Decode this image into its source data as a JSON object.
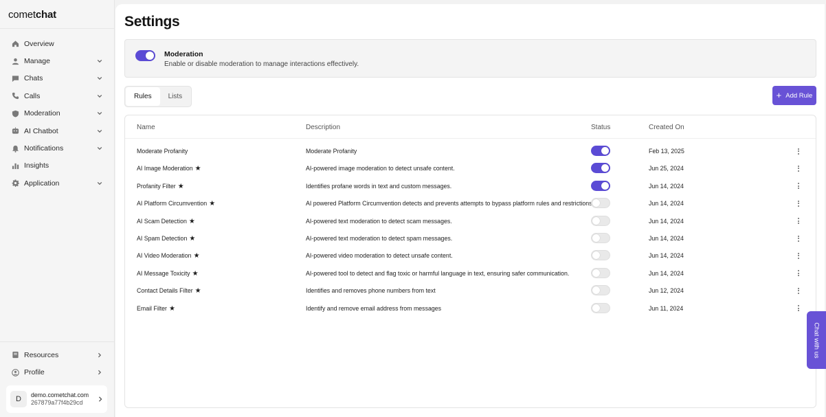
{
  "brand": {
    "logo_light": "comet",
    "logo_bold": "chat"
  },
  "sidebar": {
    "items": [
      {
        "label": "Overview",
        "icon": "home-icon",
        "chevron": false
      },
      {
        "label": "Manage",
        "icon": "user-icon",
        "chevron": true
      },
      {
        "label": "Chats",
        "icon": "chat-icon",
        "chevron": true
      },
      {
        "label": "Calls",
        "icon": "phone-icon",
        "chevron": true
      },
      {
        "label": "Moderation",
        "icon": "shield-icon",
        "chevron": true
      },
      {
        "label": "AI Chatbot",
        "icon": "bot-icon",
        "chevron": true
      },
      {
        "label": "Notifications",
        "icon": "bell-icon",
        "chevron": true
      },
      {
        "label": "Insights",
        "icon": "bar-chart-icon",
        "chevron": false
      },
      {
        "label": "Application",
        "icon": "gear-icon",
        "chevron": true
      }
    ],
    "bottom_items": [
      {
        "label": "Resources",
        "icon": "book-icon"
      },
      {
        "label": "Profile",
        "icon": "profile-icon"
      }
    ],
    "account": {
      "initial": "D",
      "domain": "demo.cometchat.com",
      "id": "267879a77f4b29cd"
    }
  },
  "page": {
    "title": "Settings",
    "moderation": {
      "title": "Moderation",
      "description": "Enable or disable moderation to manage interactions effectively.",
      "enabled": true
    },
    "tabs": [
      "Rules",
      "Lists"
    ],
    "active_tab": "Rules",
    "add_button": "Add Rule",
    "table": {
      "headers": {
        "name": "Name",
        "description": "Description",
        "status": "Status",
        "created": "Created On"
      },
      "rows": [
        {
          "name": "Moderate Profanity",
          "star": false,
          "description": "Moderate Profanity",
          "enabled": true,
          "created": "Feb 13, 2025"
        },
        {
          "name": "AI Image Moderation",
          "star": true,
          "description": "AI-powered image moderation to detect unsafe content.",
          "enabled": true,
          "created": "Jun 25, 2024"
        },
        {
          "name": "Profanity Filter",
          "star": true,
          "description": "Identifies profane words in text and custom messages.",
          "enabled": true,
          "created": "Jun 14, 2024"
        },
        {
          "name": "AI Platform Circumvention",
          "star": true,
          "description": "AI powered Platform Circumvention detects and prevents attempts to bypass platform rules and restrictions.",
          "enabled": false,
          "created": "Jun 14, 2024"
        },
        {
          "name": "AI Scam Detection",
          "star": true,
          "description": "AI-powered text moderation to detect scam messages.",
          "enabled": false,
          "created": "Jun 14, 2024"
        },
        {
          "name": "AI Spam Detection",
          "star": true,
          "description": "AI-powered text moderation to detect spam messages.",
          "enabled": false,
          "created": "Jun 14, 2024"
        },
        {
          "name": "AI Video Moderation",
          "star": true,
          "description": "AI-powered video moderation to detect unsafe content.",
          "enabled": false,
          "created": "Jun 14, 2024"
        },
        {
          "name": "AI Message Toxicity",
          "star": true,
          "description": "AI-powered tool to detect and flag toxic or harmful language in text, ensuring safer communication.",
          "enabled": false,
          "created": "Jun 14, 2024"
        },
        {
          "name": "Contact Details Filter",
          "star": true,
          "description": "Identifies and removes phone numbers from text",
          "enabled": false,
          "created": "Jun 12, 2024"
        },
        {
          "name": "Email Filter",
          "star": true,
          "description": "Identify and remove email address from messages",
          "enabled": false,
          "created": "Jun 11, 2024"
        }
      ]
    }
  },
  "chat_widget": {
    "label": "Chat with us"
  },
  "colors": {
    "accent": "#6852d6",
    "toggle_on": "#5b4bd5"
  }
}
